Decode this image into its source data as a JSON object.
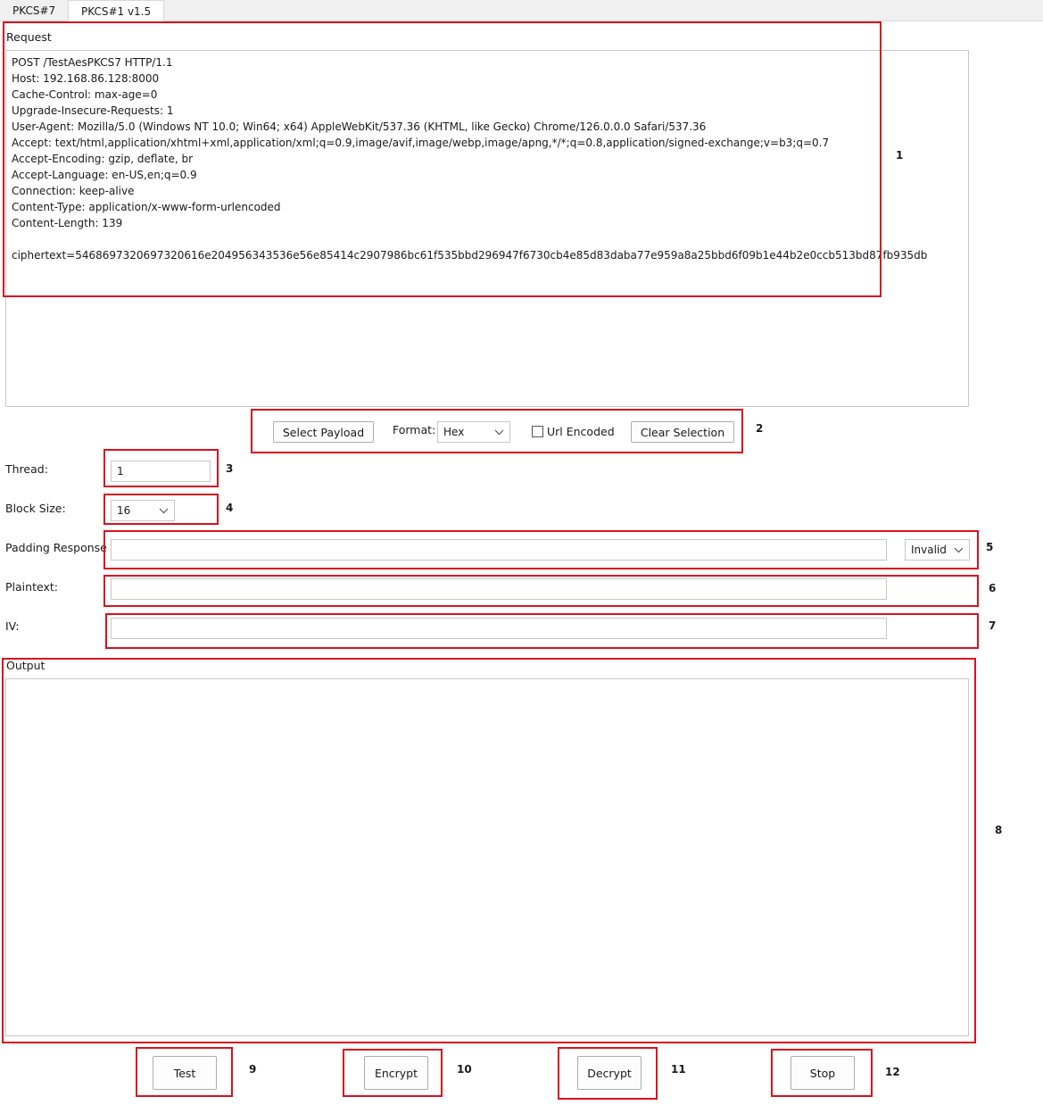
{
  "tabs": [
    {
      "label": "PKCS#7"
    },
    {
      "label": "PKCS#1 v1.5"
    }
  ],
  "request": {
    "label": "Request",
    "text": "POST /TestAesPKCS7 HTTP/1.1\nHost: 192.168.86.128:8000\nCache-Control: max-age=0\nUpgrade-Insecure-Requests: 1\nUser-Agent: Mozilla/5.0 (Windows NT 10.0; Win64; x64) AppleWebKit/537.36 (KHTML, like Gecko) Chrome/126.0.0.0 Safari/537.36\nAccept: text/html,application/xhtml+xml,application/xml;q=0.9,image/avif,image/webp,image/apng,*/*;q=0.8,application/signed-exchange;v=b3;q=0.7\nAccept-Encoding: gzip, deflate, br\nAccept-Language: en-US,en;q=0.9\nConnection: keep-alive\nContent-Type: application/x-www-form-urlencoded\nContent-Length: 139\n\nciphertext=5468697320697320616e204956343536e56e85414c2907986bc61f535bbd296947f6730cb4e85d83daba77e959a8a25bbd6f09b1e44b2e0ccb513bd87fb935db"
  },
  "payload": {
    "select_payload_label": "Select Payload",
    "format_label": "Format:",
    "format_value": "Hex",
    "url_encoded_label": "Url Encoded",
    "url_encoded_checked": false,
    "clear_selection_label": "Clear Selection"
  },
  "thread": {
    "label": "Thread:",
    "value": "1"
  },
  "block_size": {
    "label": "Block Size:",
    "value": "16"
  },
  "padding_response": {
    "label": "Padding Response",
    "value": "",
    "mode": "Invalid"
  },
  "plaintext": {
    "label": "Plaintext:",
    "value": ""
  },
  "iv": {
    "label": "IV:",
    "value": ""
  },
  "output": {
    "label": "Output",
    "text": ""
  },
  "buttons": {
    "test": "Test",
    "encrypt": "Encrypt",
    "decrypt": "Decrypt",
    "stop": "Stop"
  },
  "annotations": [
    "1",
    "2",
    "3",
    "4",
    "5",
    "6",
    "7",
    "8",
    "9",
    "10",
    "11",
    "12"
  ],
  "colors": {
    "annotation_box": "#d9121e",
    "tab_bar": "#f0f0f0"
  }
}
